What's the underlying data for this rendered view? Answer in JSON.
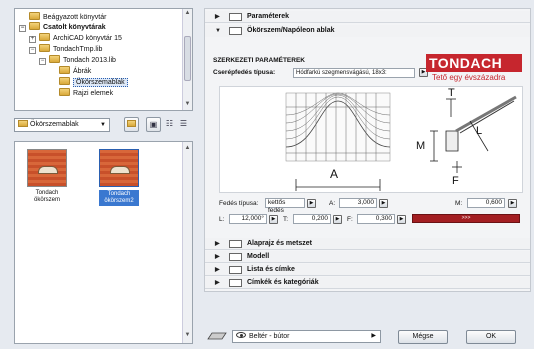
{
  "tree": {
    "items": [
      {
        "label": "Beágyazott könyvtár",
        "bold": false,
        "selected": false
      },
      {
        "label": "Csatolt könyvtárak",
        "bold": true,
        "selected": false
      },
      {
        "label": "ArchiCAD könyvtár 15",
        "bold": false,
        "selected": false
      },
      {
        "label": "TondachTmp.lib",
        "bold": false,
        "selected": false
      },
      {
        "label": "Tondach 2013.lib",
        "bold": false,
        "selected": false
      },
      {
        "label": "Ábrák",
        "bold": false,
        "selected": false
      },
      {
        "label": "Ökörszemablak",
        "bold": false,
        "selected": true
      },
      {
        "label": "Rajzi elemek",
        "bold": false,
        "selected": false
      }
    ]
  },
  "folder_select": {
    "value": "Ökörszemablak"
  },
  "objects": [
    {
      "label": "Tondach ökörszem",
      "selected": false
    },
    {
      "label": "Tondach ökörszem2",
      "selected": true
    }
  ],
  "sections": {
    "parameters": "Paraméterek",
    "dormer": "Ökörszem/Napóleon ablak",
    "plan_section": "Alaprajz és metszet",
    "model": "Modell",
    "listing": "Lista és címke",
    "tags": "Címkék és kategóriák"
  },
  "structural": {
    "heading": "SZERKEZETI PARAMÉTEREK",
    "tile_type_label": "Cserépfedés típusa:",
    "tile_type_value": "Hódfarkú szegmensvágású, 18x3:"
  },
  "logo": {
    "name": "TONDACH",
    "tagline": "Tető egy évszázadra"
  },
  "drawing_labels": {
    "a": "A",
    "m": "M",
    "t": "T",
    "l": "L",
    "f": "F"
  },
  "params": {
    "cover_type_label": "Fedés típusa:",
    "cover_type_value": "kettős fedés",
    "a_label": "A:",
    "a_value": "3,000",
    "m_label": "M:",
    "m_value": "0,600",
    "l_label": "L:",
    "l_value": "12,000°",
    "t_label": "T:",
    "t_value": "0,200",
    "f_label": "F:",
    "f_value": "0,300",
    "redbar_label": ">>>"
  },
  "footer": {
    "layer_value": "Beltér - bútor",
    "cancel": "Mégse",
    "ok": "OK"
  },
  "colors": {
    "brand": "#c6262e",
    "selection": "#3a78d0"
  }
}
